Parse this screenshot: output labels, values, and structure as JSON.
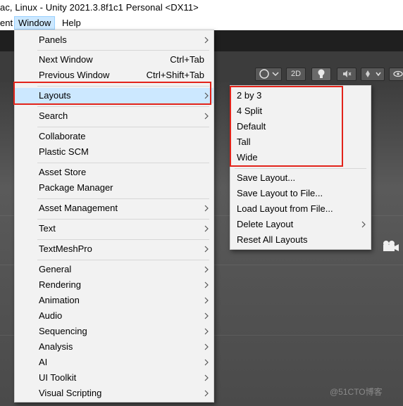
{
  "titlebar": {
    "text": "ac, Linux - Unity 2021.3.8f1c1 Personal <DX11>"
  },
  "menubar": {
    "items": [
      {
        "label": "ent"
      },
      {
        "label": "Window"
      },
      {
        "label": "Help"
      }
    ]
  },
  "scene_toolbar": {
    "twod_label": "2D"
  },
  "window_menu": {
    "items": [
      {
        "label": "Panels",
        "shortcut": "",
        "submenu": true
      },
      {
        "label": "Next Window",
        "shortcut": "Ctrl+Tab",
        "submenu": false
      },
      {
        "label": "Previous Window",
        "shortcut": "Ctrl+Shift+Tab",
        "submenu": false
      },
      {
        "label": "Layouts",
        "shortcut": "",
        "submenu": true,
        "highlighted": true
      },
      {
        "label": "Search",
        "shortcut": "",
        "submenu": true
      },
      {
        "label": "Collaborate",
        "shortcut": "",
        "submenu": false
      },
      {
        "label": "Plastic SCM",
        "shortcut": "",
        "submenu": false
      },
      {
        "label": "Asset Store",
        "shortcut": "",
        "submenu": false
      },
      {
        "label": "Package Manager",
        "shortcut": "",
        "submenu": false
      },
      {
        "label": "Asset Management",
        "shortcut": "",
        "submenu": true
      },
      {
        "label": "Text",
        "shortcut": "",
        "submenu": true
      },
      {
        "label": "TextMeshPro",
        "shortcut": "",
        "submenu": true
      },
      {
        "label": "General",
        "shortcut": "",
        "submenu": true
      },
      {
        "label": "Rendering",
        "shortcut": "",
        "submenu": true
      },
      {
        "label": "Animation",
        "shortcut": "",
        "submenu": true
      },
      {
        "label": "Audio",
        "shortcut": "",
        "submenu": true
      },
      {
        "label": "Sequencing",
        "shortcut": "",
        "submenu": true
      },
      {
        "label": "Analysis",
        "shortcut": "",
        "submenu": true
      },
      {
        "label": "AI",
        "shortcut": "",
        "submenu": true
      },
      {
        "label": "UI Toolkit",
        "shortcut": "",
        "submenu": true
      },
      {
        "label": "Visual Scripting",
        "shortcut": "",
        "submenu": true
      }
    ]
  },
  "layouts_menu": {
    "items": [
      {
        "label": "2 by 3",
        "submenu": false
      },
      {
        "label": "4 Split",
        "submenu": false
      },
      {
        "label": "Default",
        "submenu": false
      },
      {
        "label": "Tall",
        "submenu": false
      },
      {
        "label": "Wide",
        "submenu": false
      },
      {
        "label": "Save Layout...",
        "submenu": false
      },
      {
        "label": "Save Layout to File...",
        "submenu": false
      },
      {
        "label": "Load Layout from File...",
        "submenu": false
      },
      {
        "label": "Delete Layout",
        "submenu": true
      },
      {
        "label": "Reset All Layouts",
        "submenu": false
      }
    ]
  },
  "watermark": "@51CTO博客",
  "colors": {
    "highlight": "#cce8ff",
    "annotation_red": "#e2231a",
    "menu_bg": "#f2f2f2"
  }
}
